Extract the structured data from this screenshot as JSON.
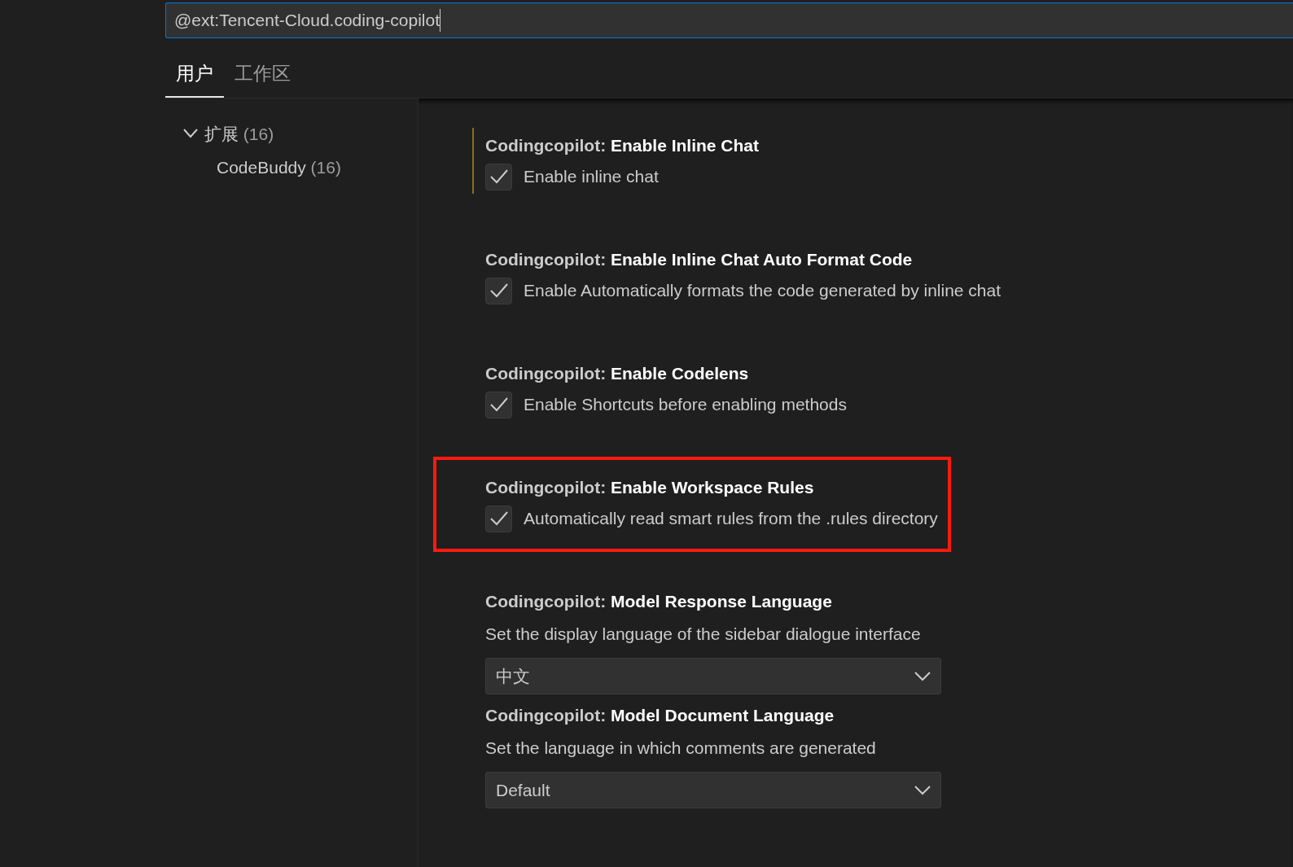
{
  "search": {
    "value": "@ext:Tencent-Cloud.coding-copilot",
    "focused": true
  },
  "tabs": [
    {
      "label": "用户",
      "selected": true
    },
    {
      "label": "工作区",
      "selected": false
    }
  ],
  "tree": [
    {
      "label": "扩展",
      "count": "(16)",
      "expanded": true,
      "children": [
        {
          "label": "CodeBuddy",
          "count": "(16)"
        }
      ]
    }
  ],
  "settings": [
    {
      "kind": "checkbox",
      "category": "Codingcopilot:",
      "name": "Enable Inline Chat",
      "description": "Enable inline chat",
      "checked": true,
      "focused": true,
      "highlighted": false
    },
    {
      "kind": "checkbox",
      "category": "Codingcopilot:",
      "name": "Enable Inline Chat Auto Format Code",
      "description": "Enable Automatically formats the code generated by inline chat",
      "checked": true,
      "focused": false,
      "highlighted": false
    },
    {
      "kind": "checkbox",
      "category": "Codingcopilot:",
      "name": "Enable Codelens",
      "description": "Enable Shortcuts before enabling methods",
      "checked": true,
      "focused": false,
      "highlighted": false
    },
    {
      "kind": "checkbox",
      "category": "Codingcopilot:",
      "name": "Enable Workspace Rules",
      "description": "Automatically read smart rules from the .rules directory",
      "checked": true,
      "focused": false,
      "highlighted": true
    },
    {
      "kind": "dropdown",
      "category": "Codingcopilot:",
      "name": "Model Response Language",
      "description": "Set the display language of the sidebar dialogue interface",
      "value": "中文",
      "focused": false,
      "highlighted": false
    },
    {
      "kind": "dropdown",
      "category": "Codingcopilot:",
      "name": "Model Document Language",
      "description": "Set the language in which comments are generated",
      "value": "Default",
      "focused": false,
      "highlighted": false
    }
  ]
}
